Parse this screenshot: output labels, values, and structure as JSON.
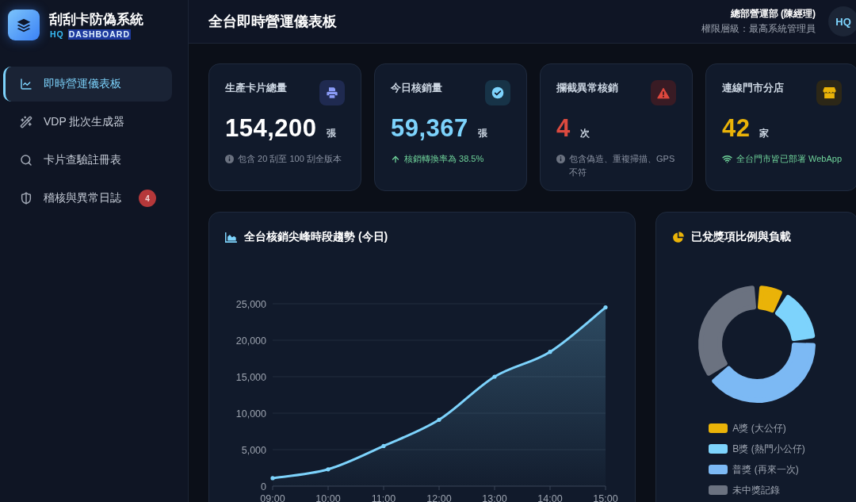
{
  "sidebar": {
    "brand": {
      "title": "刮刮卡防偽系統",
      "subtitle": [
        {
          "text": "HQ",
          "highlighted": false
        },
        {
          "text": "DASHBOARD",
          "highlighted": true
        }
      ]
    },
    "nav": [
      {
        "kind": "chart",
        "label": "即時營運儀表板",
        "selected": true
      },
      {
        "kind": "wand",
        "label": "VDP 批次生成器",
        "selected": false
      },
      {
        "kind": "search",
        "label": "卡片查驗註冊表",
        "selected": false
      },
      {
        "kind": "shield",
        "label": "稽核與異常日誌",
        "selected": false,
        "badge": "4"
      }
    ]
  },
  "header": {
    "title": "全台即時營運儀表板",
    "user": {
      "name": "總部營運部 (陳經理)",
      "role": "權限層級：最高系統管理員",
      "avatar": "HQ"
    }
  },
  "stats": [
    {
      "kind": "printer",
      "label": "生產卡片總量",
      "value": "154,200",
      "unit": "張",
      "color": "#ffffff",
      "note": {
        "kind": "info",
        "text": "包含 20 刮至 100 刮全版本"
      }
    },
    {
      "kind": "check",
      "label": "今日核銷量",
      "value": "59,367",
      "unit": "張",
      "color": "#7dd3fc",
      "note": {
        "kind": "up",
        "text": "核銷轉換率為 38.5%"
      }
    },
    {
      "kind": "alert",
      "label": "攔截異常核銷",
      "value": "4",
      "unit": "次",
      "color": "#dc4a3f",
      "note": {
        "kind": "info",
        "text": "包含偽造、重複掃描、GPS 不符"
      }
    },
    {
      "kind": "store",
      "label": "連線門市分店",
      "value": "42",
      "unit": "家",
      "color": "#eab308",
      "note": {
        "kind": "wifi",
        "text": "全台門市皆已部署 WebApp"
      }
    }
  ],
  "trend": {
    "chart_data": {
      "type": "area",
      "title": "全台核銷尖峰時段趨勢 (今日)",
      "categories": [
        "09:00",
        "10:00",
        "11:00",
        "12:00",
        "13:00",
        "14:00",
        "15:00"
      ],
      "series": [
        {
          "color": "#7dd3fc",
          "values": [
            1100,
            2300,
            5500,
            9100,
            15000,
            18400,
            24500
          ]
        }
      ],
      "ylim": [
        0,
        25000
      ],
      "yticks": [
        {
          "value": 0,
          "label": "0"
        },
        {
          "value": 5000,
          "label": "5,000"
        },
        {
          "value": 10000,
          "label": "10,000"
        },
        {
          "value": 15000,
          "label": "15,000"
        },
        {
          "value": 20000,
          "label": "20,000"
        },
        {
          "value": 25000,
          "label": "25,000"
        }
      ],
      "grid": true
    }
  },
  "prizes": {
    "chart_data": {
      "type": "donut",
      "title": "已兌獎項比例與負載",
      "categories": [
        "A獎 (大公仔)",
        "B獎 (熱門小公仔)",
        "普獎 (再來一次)",
        "未中獎記錄"
      ],
      "values": [
        8,
        16,
        41,
        35
      ],
      "colors": [
        "#eab308",
        "#7dd3fc",
        "#7cb9f4",
        "#6b7280"
      ],
      "legend": true
    }
  }
}
